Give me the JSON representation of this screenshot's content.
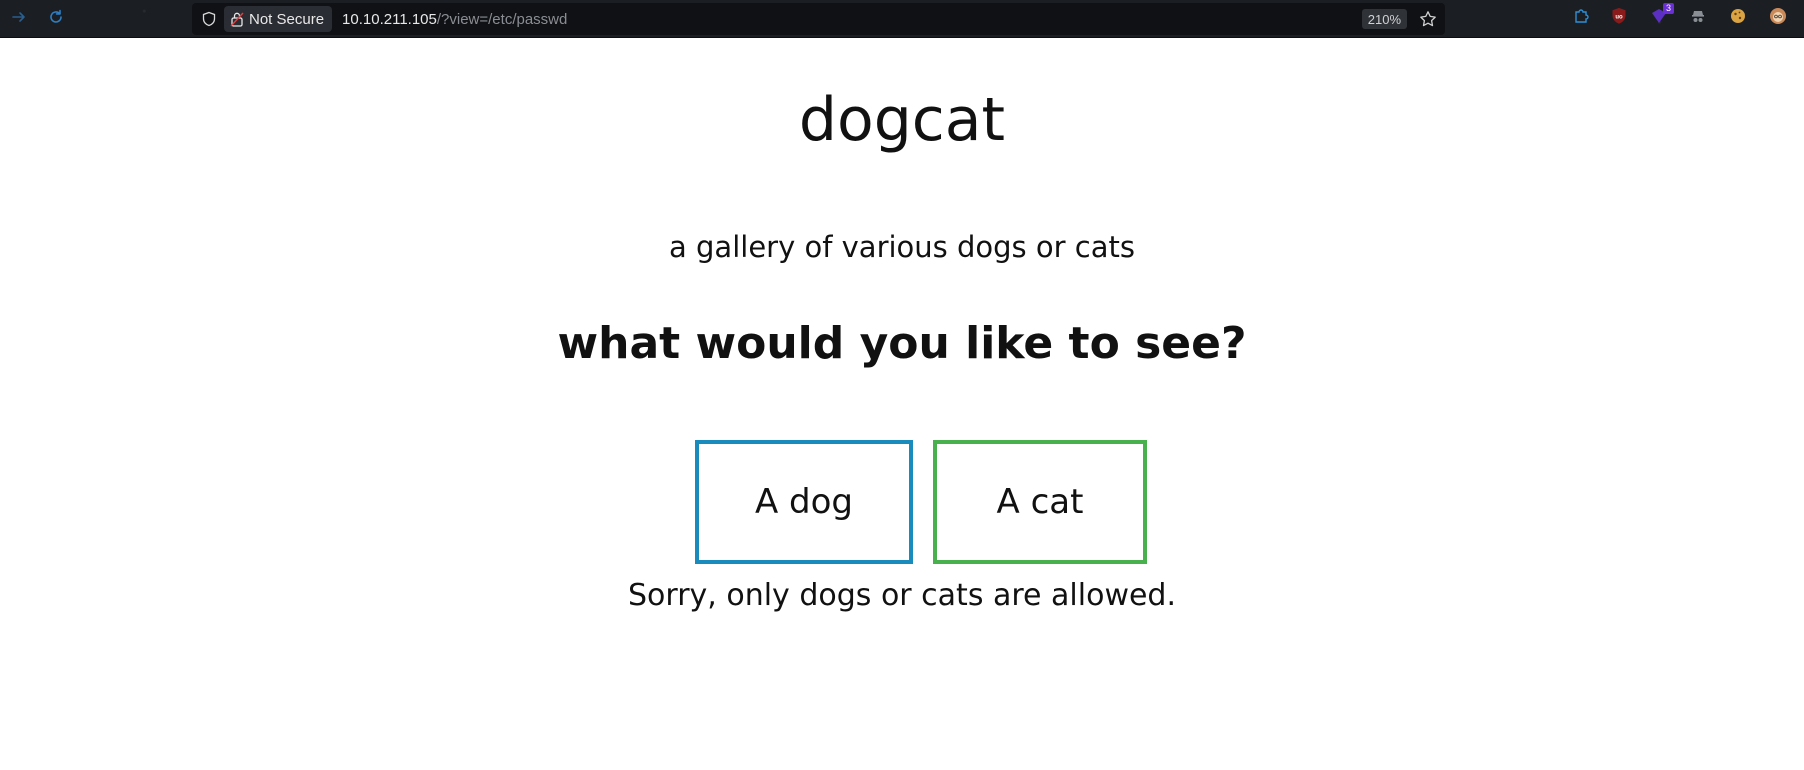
{
  "browser": {
    "url_host": "10.10.211.105",
    "url_path": "/?view=/etc/passwd",
    "security_label": "Not Secure",
    "zoom": "210%",
    "extension_badge": "3",
    "icons": {
      "forward": "arrow-right-icon",
      "reload": "reload-icon",
      "shield": "shield-icon",
      "lock": "insecure-lock-icon",
      "bookmark": "star-icon"
    },
    "colors": {
      "toolbar": "#1b1f24",
      "urlbar": "#0f1114",
      "nav_accent": "#2d7fc4"
    }
  },
  "page": {
    "title": "dogcat",
    "subtitle": "a gallery of various dogs or cats",
    "question": "what would you like to see?",
    "dog_button": "A dog",
    "cat_button": "A cat",
    "message": "Sorry, only dogs or cats are allowed.",
    "colors": {
      "dog_border": "#1a8bbd",
      "cat_border": "#48b04c",
      "text": "#111111"
    }
  }
}
